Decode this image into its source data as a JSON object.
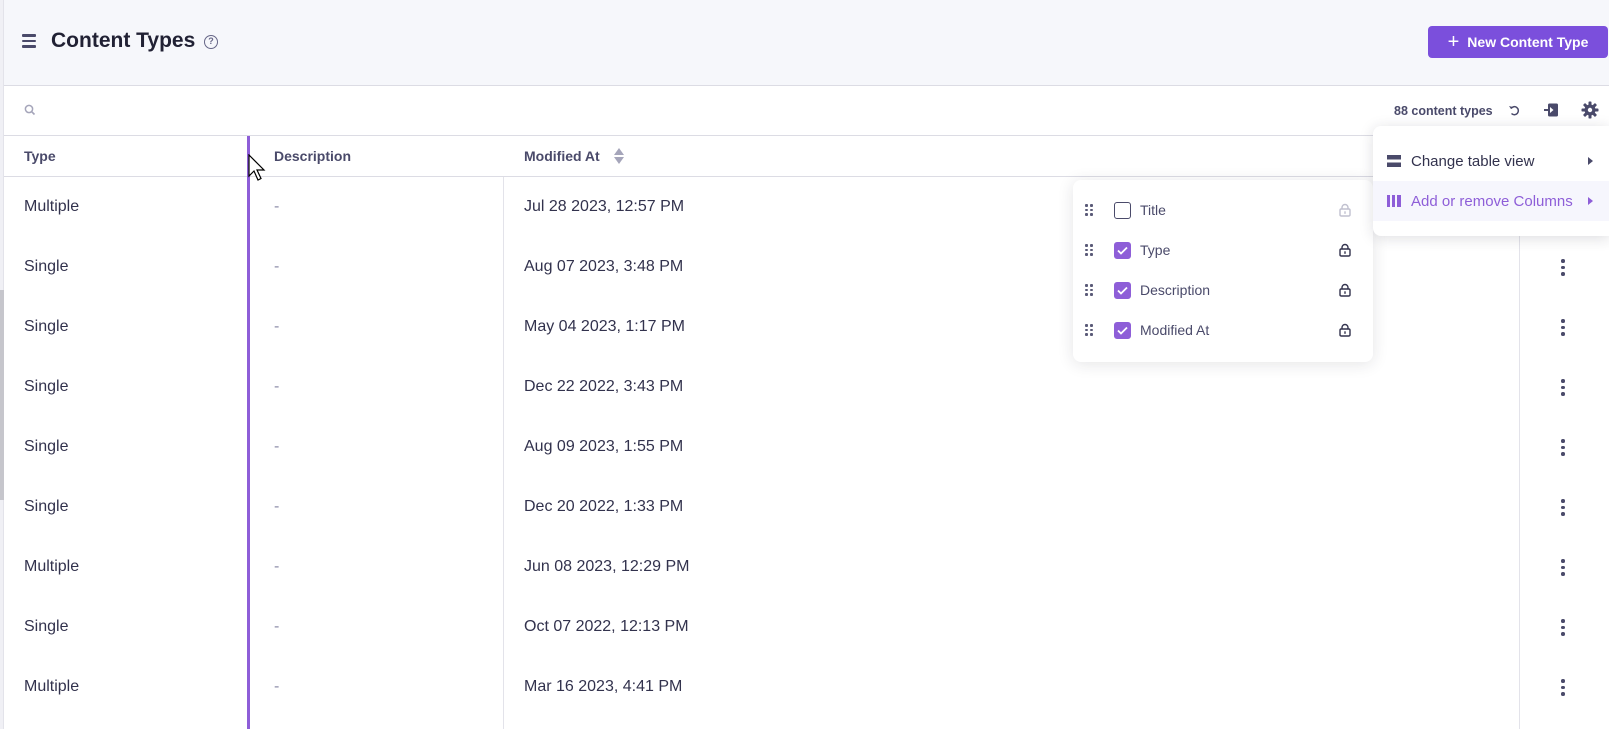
{
  "header": {
    "title": "Content Types",
    "new_button_label": "New Content Type",
    "brand_color": "#7b4fdc"
  },
  "toolbar": {
    "search_placeholder": "",
    "count_label": "88 content types"
  },
  "table": {
    "columns": [
      "Type",
      "Description",
      "Modified At"
    ],
    "sorted_column": "Modified At",
    "rows": [
      {
        "type": "Multiple",
        "description": "-",
        "modified": "Jul 28 2023, 12:57 PM"
      },
      {
        "type": "Single",
        "description": "-",
        "modified": "Aug 07 2023, 3:48 PM"
      },
      {
        "type": "Single",
        "description": "-",
        "modified": "May 04 2023, 1:17 PM"
      },
      {
        "type": "Single",
        "description": "-",
        "modified": "Dec 22 2022, 3:43 PM"
      },
      {
        "type": "Single",
        "description": "-",
        "modified": "Aug 09 2023, 1:55 PM"
      },
      {
        "type": "Single",
        "description": "-",
        "modified": "Dec 20 2022, 1:33 PM"
      },
      {
        "type": "Multiple",
        "description": "-",
        "modified": "Jun 08 2023, 12:29 PM"
      },
      {
        "type": "Single",
        "description": "-",
        "modified": "Oct 07 2022, 12:13 PM"
      },
      {
        "type": "Multiple",
        "description": "-",
        "modified": "Mar 16 2023, 4:41 PM"
      }
    ]
  },
  "settings_menu": {
    "items": [
      {
        "label": "Change table view",
        "icon": "rows-icon",
        "active": false
      },
      {
        "label": "Add or remove Columns",
        "icon": "columns-icon",
        "active": true
      }
    ]
  },
  "columns_panel": {
    "items": [
      {
        "label": "Title",
        "checked": false,
        "locked_disabled": true
      },
      {
        "label": "Type",
        "checked": true,
        "locked_disabled": false
      },
      {
        "label": "Description",
        "checked": true,
        "locked_disabled": false
      },
      {
        "label": "Modified At",
        "checked": true,
        "locked_disabled": false
      }
    ]
  }
}
